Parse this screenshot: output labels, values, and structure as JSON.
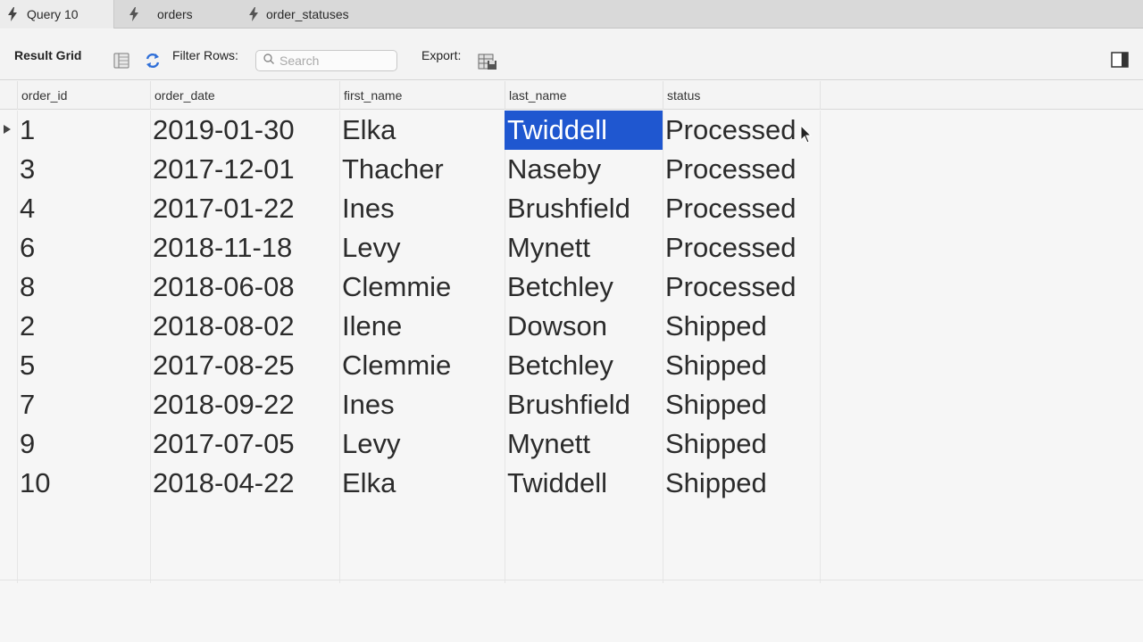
{
  "tabs": [
    {
      "label": "Query 10",
      "icon": "lightning-icon",
      "active": true
    },
    {
      "label": "orders",
      "icon": "lightning-icon",
      "active": false
    },
    {
      "label": "order_statuses",
      "icon": "lightning-icon",
      "active": false
    }
  ],
  "toolbar": {
    "result_grid_label": "Result Grid",
    "filter_rows_label": "Filter Rows:",
    "search_placeholder": "Search",
    "search_value": "",
    "export_label": "Export:"
  },
  "grid": {
    "columns": [
      "order_id",
      "order_date",
      "first_name",
      "last_name",
      "status"
    ],
    "rows": [
      [
        "1",
        "2019-01-30",
        "Elka",
        "Twiddell",
        "Processed"
      ],
      [
        "3",
        "2017-12-01",
        "Thacher",
        "Naseby",
        "Processed"
      ],
      [
        "4",
        "2017-01-22",
        "Ines",
        "Brushfield",
        "Processed"
      ],
      [
        "6",
        "2018-11-18",
        "Levy",
        "Mynett",
        "Processed"
      ],
      [
        "8",
        "2018-06-08",
        "Clemmie",
        "Betchley",
        "Processed"
      ],
      [
        "2",
        "2018-08-02",
        "Ilene",
        "Dowson",
        "Shipped"
      ],
      [
        "5",
        "2017-08-25",
        "Clemmie",
        "Betchley",
        "Shipped"
      ],
      [
        "7",
        "2018-09-22",
        "Ines",
        "Brushfield",
        "Shipped"
      ],
      [
        "9",
        "2017-07-05",
        "Levy",
        "Mynett",
        "Shipped"
      ],
      [
        "10",
        "2018-04-22",
        "Elka",
        "Twiddell",
        "Shipped"
      ]
    ],
    "selected_cell": {
      "row": 0,
      "column": "last_name"
    },
    "current_row": 0
  },
  "colors": {
    "selection": "#1f57d0",
    "refresh_icon": "#2f6fd8"
  }
}
